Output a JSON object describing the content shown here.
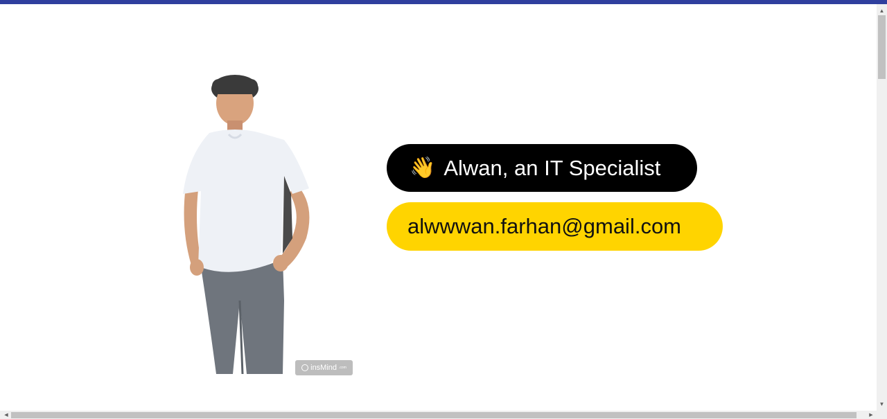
{
  "header": {
    "accent_color": "#2f3f9e"
  },
  "profile": {
    "photo_icon": "person-photo",
    "watermark_text": "insMind",
    "watermark_suffix": ".com",
    "wave_emoji": "👋",
    "name_text": "Alwan, an IT Specialist",
    "email_text": "alwwwan.farhan@gmail.com"
  },
  "colors": {
    "name_pill": "#000000",
    "email_pill": "#ffd400"
  },
  "scrollbars": {
    "up_arrow": "▲",
    "down_arrow": "▼",
    "left_arrow": "◀",
    "right_arrow": "▶"
  }
}
